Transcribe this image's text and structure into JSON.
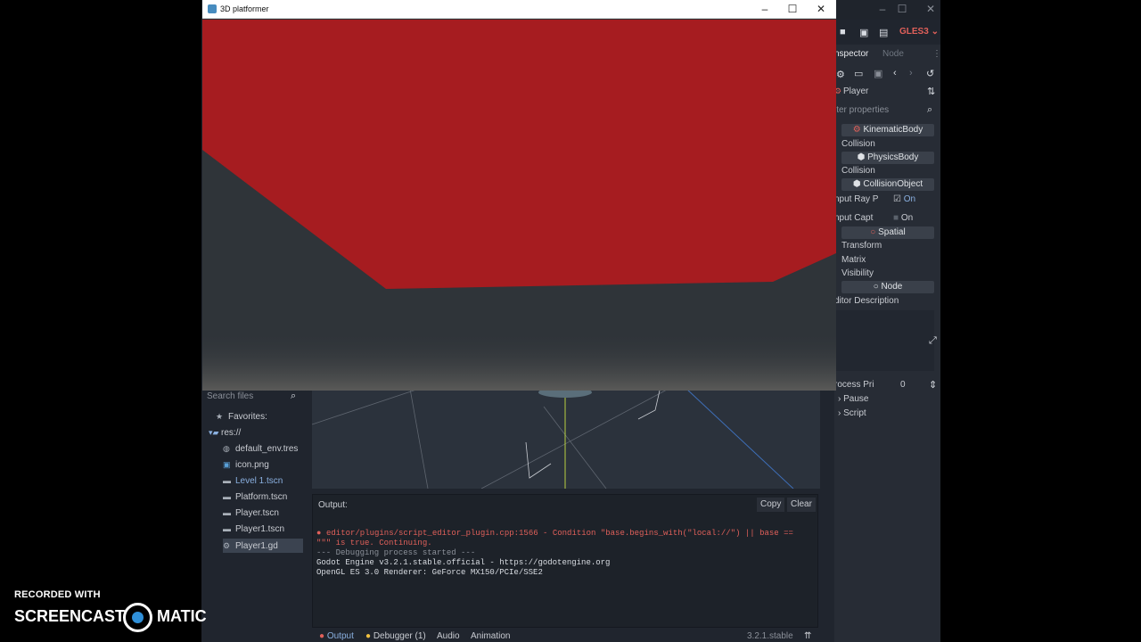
{
  "editor": {
    "window_controls": [
      "–",
      "☐",
      "✕"
    ],
    "renderer": "GLES3",
    "inspector": {
      "tabs": [
        "nspector",
        "Node"
      ],
      "node_name": "Player",
      "filter_placeholder": "lter properties",
      "rows": {
        "kinematic_body": "KinematicBody",
        "collision_1": "Collision",
        "physics_body": "PhysicsBody",
        "collision_2": "Collision",
        "collision_object": "CollisionObject",
        "input_ray_label": "nput Ray P",
        "input_ray_value": "On",
        "input_capt_label": "nput Capt",
        "input_capt_value": "On",
        "spatial": "Spatial",
        "transform": "Transform",
        "matrix": "Matrix",
        "visibility": "Visibility",
        "node": "Node",
        "editor_description": "ditor Description",
        "process_pri_label": "rocess Pri",
        "process_pri_value": "0",
        "pause": "Pause",
        "script": "Script"
      }
    },
    "filesystem": {
      "search_placeholder": "Search files",
      "favorites": "Favorites:",
      "root": "res://",
      "files": [
        "default_env.tres",
        "icon.png",
        "Level 1.tscn",
        "Platform.tscn",
        "Player.tscn",
        "Player1.tscn",
        "Player1.gd"
      ]
    },
    "output": {
      "title": "Output:",
      "copy": "Copy",
      "clear": "Clear",
      "lines": [
        "editor/plugins/script_editor_plugin.cpp:1566 - Condition \"base.begins_with(\"local://\") || base ==",
        "\"\"\" is true. Continuing.",
        "--- Debugging process started ---",
        "Godot Engine v3.2.1.stable.official - https://godotengine.org",
        "OpenGL ES 3.0 Renderer: GeForce MX150/PCIe/SSE2"
      ]
    },
    "bottom_tabs": [
      "Output",
      "Debugger (1)",
      "Audio",
      "Animation"
    ],
    "version": "3.2.1.stable"
  },
  "game_window": {
    "title": "3D platformer",
    "controls": [
      "–",
      "☐",
      "✕"
    ]
  },
  "watermark": {
    "line1": "RECORDED WITH",
    "word1": "SCREENCAST",
    "word2": "MATIC"
  },
  "colors": {
    "red_platform": "#a61c20",
    "editor_bg": "#20252e",
    "error_red": "#e0605a"
  }
}
